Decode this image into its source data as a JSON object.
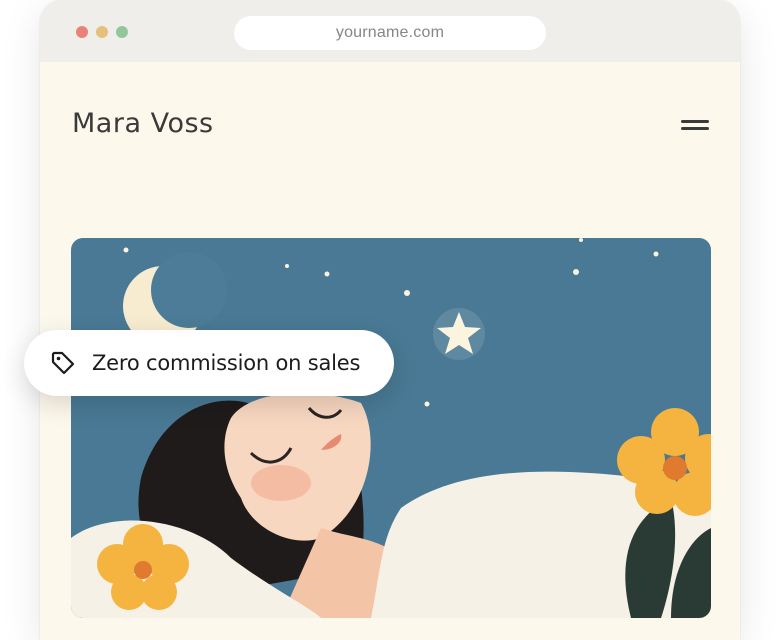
{
  "browser": {
    "url": "yourname.com",
    "window_controls": [
      "close-dot",
      "minimize-dot",
      "maximize-dot"
    ]
  },
  "site": {
    "title": "Mara Voss",
    "menu_icon": "hamburger-menu-icon"
  },
  "hero": {
    "image_description_icon": "illustration-sleeping-woman-night-sky"
  },
  "feature_badge": {
    "icon": "tag-icon",
    "text": "Zero commission on sales"
  },
  "colors": {
    "page_background": "#fdf8ec",
    "chrome": "#f0eeea",
    "sky": "#4c7c97",
    "flower": "#f4b43f"
  }
}
